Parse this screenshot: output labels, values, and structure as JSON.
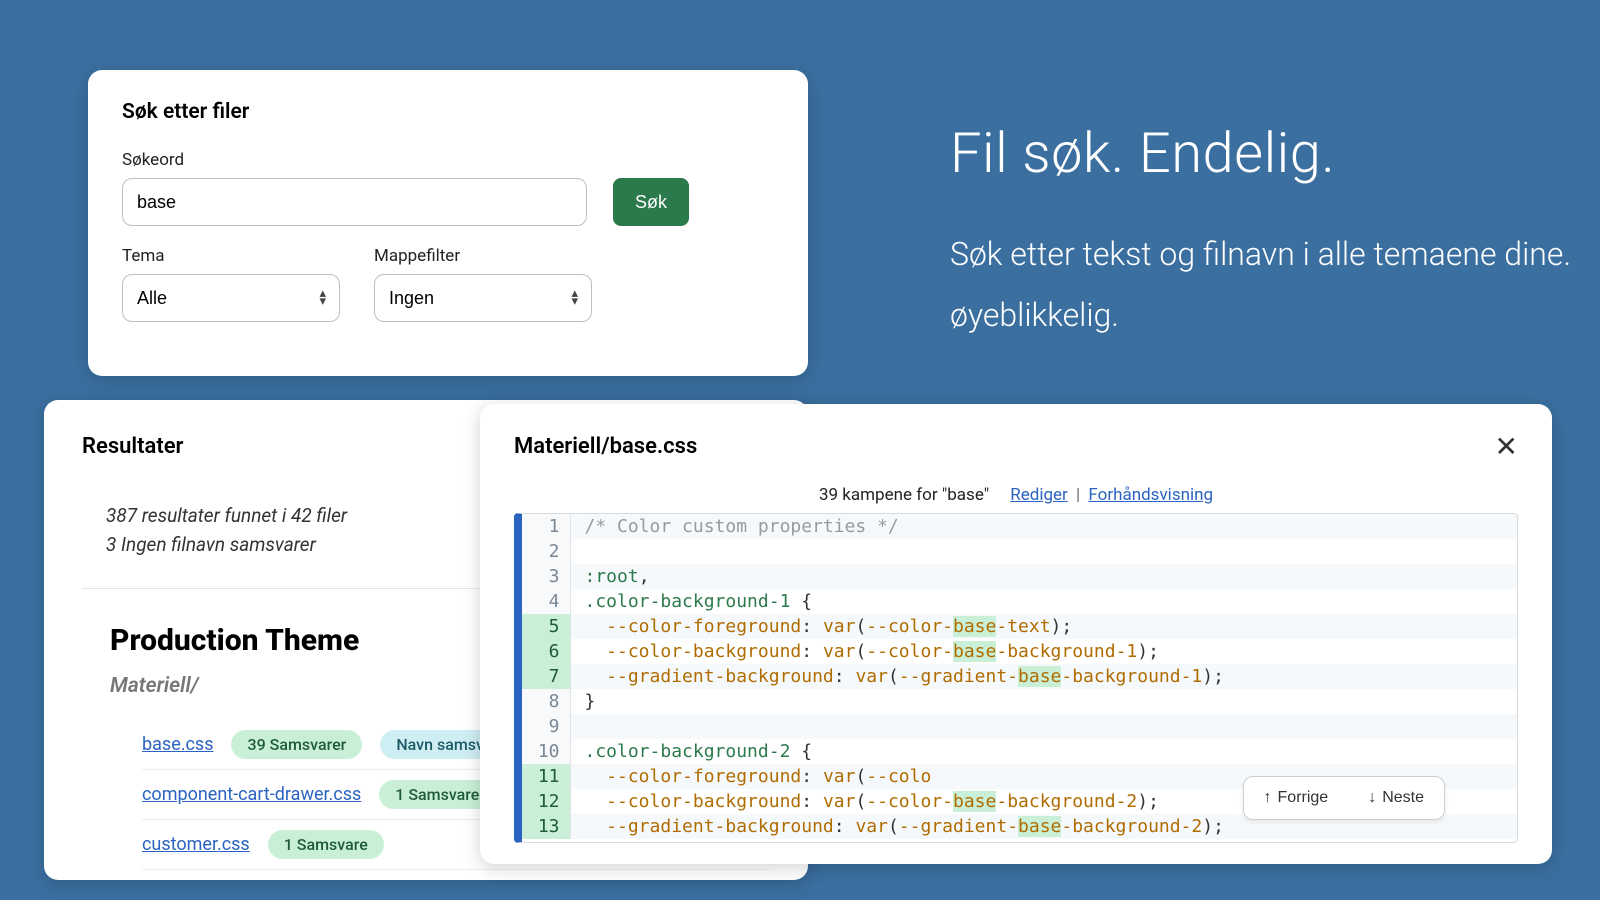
{
  "hero": {
    "title": "Fil søk. Endelig.",
    "subtitle": "Søk etter tekst og filnavn i alle temaene dine. øyeblikkelig."
  },
  "search": {
    "heading": "Søk etter filer",
    "keyword_label": "Søkeord",
    "keyword_value": "base",
    "submit_label": "Søk",
    "theme_label": "Tema",
    "theme_value": "Alle",
    "folder_label": "Mappefilter",
    "folder_value": "Ingen"
  },
  "results": {
    "heading": "Resultater",
    "summary_line1": "387 resultater funnet i 42 filer",
    "summary_line2": "3 Ingen filnavn samsvarer",
    "theme_title": "Production Theme",
    "folder_name": "Materiell/",
    "files": [
      {
        "name": "base.css",
        "badge": "39 Samsvarer",
        "extra": "Navn samsvar"
      },
      {
        "name": "component-cart-drawer.css",
        "badge": "1 Samsvare"
      },
      {
        "name": "customer.css",
        "badge": "1 Samsvare"
      }
    ]
  },
  "preview": {
    "title": "Materiell/base.css",
    "matches_text": "39 kampene for \"base\"",
    "edit_label": "Rediger",
    "preview_label": "Forhåndsvisning",
    "prev_label": "Forrige",
    "next_label": "Neste",
    "lines": [
      {
        "n": 1,
        "hit": false,
        "tokens": [
          [
            "/* Color custom properties */",
            "comment"
          ]
        ]
      },
      {
        "n": 2,
        "hit": false,
        "tokens": [
          [
            "",
            ""
          ]
        ]
      },
      {
        "n": 3,
        "hit": false,
        "tokens": [
          [
            ":root",
            "sel"
          ],
          [
            ",",
            "punc"
          ]
        ]
      },
      {
        "n": 4,
        "hit": false,
        "tokens": [
          [
            ".color-background-1",
            "sel"
          ],
          [
            " {",
            "punc"
          ]
        ]
      },
      {
        "n": 5,
        "hit": true,
        "tokens": [
          [
            "  --color-foreground",
            "prop"
          ],
          [
            ": ",
            "punc"
          ],
          [
            "var",
            "val"
          ],
          [
            "(",
            "punc"
          ],
          [
            "--color-",
            "val"
          ],
          [
            "base",
            "hl"
          ],
          [
            "-text",
            "val"
          ],
          [
            ")",
            "punc"
          ],
          [
            ";",
            "punc"
          ]
        ]
      },
      {
        "n": 6,
        "hit": true,
        "tokens": [
          [
            "  --color-background",
            "prop"
          ],
          [
            ": ",
            "punc"
          ],
          [
            "var",
            "val"
          ],
          [
            "(",
            "punc"
          ],
          [
            "--color-",
            "val"
          ],
          [
            "base",
            "hl"
          ],
          [
            "-background-1",
            "val"
          ],
          [
            ")",
            "punc"
          ],
          [
            ";",
            "punc"
          ]
        ]
      },
      {
        "n": 7,
        "hit": true,
        "tokens": [
          [
            "  --gradient-background",
            "prop"
          ],
          [
            ": ",
            "punc"
          ],
          [
            "var",
            "val"
          ],
          [
            "(",
            "punc"
          ],
          [
            "--gradient-",
            "val"
          ],
          [
            "base",
            "hl"
          ],
          [
            "-background-1",
            "val"
          ],
          [
            ")",
            "punc"
          ],
          [
            ";",
            "punc"
          ]
        ]
      },
      {
        "n": 8,
        "hit": false,
        "tokens": [
          [
            "}",
            "punc"
          ]
        ]
      },
      {
        "n": 9,
        "hit": false,
        "tokens": [
          [
            "",
            ""
          ]
        ]
      },
      {
        "n": 10,
        "hit": false,
        "tokens": [
          [
            ".color-background-2",
            "sel"
          ],
          [
            " {",
            "punc"
          ]
        ]
      },
      {
        "n": 11,
        "hit": true,
        "tokens": [
          [
            "  --color-foreground",
            "prop"
          ],
          [
            ": ",
            "punc"
          ],
          [
            "var",
            "val"
          ],
          [
            "(",
            "punc"
          ],
          [
            "--colo",
            "val"
          ]
        ]
      },
      {
        "n": 12,
        "hit": true,
        "tokens": [
          [
            "  --color-background",
            "prop"
          ],
          [
            ": ",
            "punc"
          ],
          [
            "var",
            "val"
          ],
          [
            "(",
            "punc"
          ],
          [
            "--color-",
            "val"
          ],
          [
            "base",
            "hl"
          ],
          [
            "-background-2",
            "val"
          ],
          [
            ")",
            "punc"
          ],
          [
            ";",
            "punc"
          ]
        ]
      },
      {
        "n": 13,
        "hit": true,
        "tokens": [
          [
            "  --gradient-background",
            "prop"
          ],
          [
            ": ",
            "punc"
          ],
          [
            "var",
            "val"
          ],
          [
            "(",
            "punc"
          ],
          [
            "--gradient-",
            "val"
          ],
          [
            "base",
            "hl"
          ],
          [
            "-background-2",
            "val"
          ],
          [
            ")",
            "punc"
          ],
          [
            ";",
            "punc"
          ]
        ]
      }
    ]
  }
}
